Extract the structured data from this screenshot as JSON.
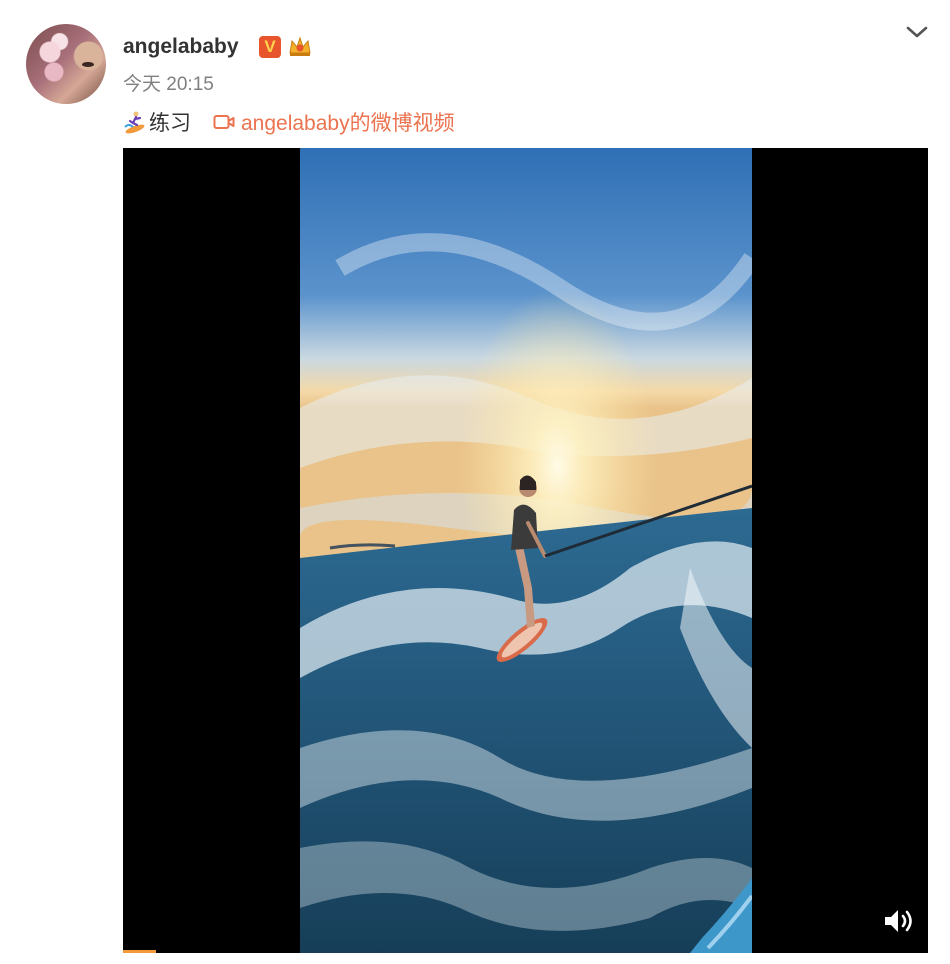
{
  "post": {
    "author": {
      "username": "angelababy",
      "verified_badge": "V",
      "avatar_icon": "avatar",
      "crown_icon": "crown-icon"
    },
    "timestamp": "今天 20:15",
    "text": "练习",
    "text_emoji": "surfing-emoji-icon",
    "video_link": "angelababy的微博视频",
    "video_link_icon": "video-camera-icon",
    "menu_icon": "chevron-down-icon"
  },
  "video": {
    "volume_icon": "volume-icon",
    "progress": 0.04
  },
  "colors": {
    "link": "#eb7350",
    "badge": "#e8542b",
    "username": "#333333",
    "timestamp": "#808080"
  }
}
